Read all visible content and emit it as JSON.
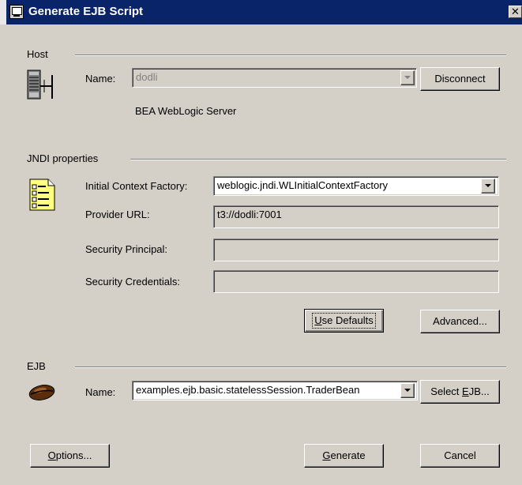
{
  "window": {
    "title": "Generate EJB Script"
  },
  "host": {
    "section_label": "Host",
    "name_label": "Name:",
    "name_value": "dodli",
    "disconnect_label": "Disconnect",
    "server_label": "BEA WebLogic Server"
  },
  "jndi": {
    "section_label": "JNDI properties",
    "factory_label": "Initial Context Factory:",
    "factory_value": "weblogic.jndi.WLInitialContextFactory",
    "provider_label": "Provider URL:",
    "provider_value": "t3://dodli:7001",
    "principal_label": "Security Principal:",
    "principal_value": "",
    "credentials_label": "Security Credentials:",
    "credentials_value": "",
    "use_defaults": {
      "pre": "",
      "u": "U",
      "post": "se Defaults"
    },
    "advanced": {
      "pre": "Advanced",
      "u": "",
      "post": "..."
    }
  },
  "ejb": {
    "section_label": "EJB",
    "name_label": "Name:",
    "name_value": "examples.ejb.basic.statelessSession.TraderBean",
    "select_ejb": {
      "pre": "Select ",
      "u": "E",
      "post": "JB..."
    }
  },
  "footer": {
    "options": {
      "pre": "",
      "u": "O",
      "post": "ptions..."
    },
    "generate": {
      "pre": "",
      "u": "G",
      "post": "enerate"
    },
    "cancel": "Cancel"
  },
  "colors": {
    "title_bar": "#0a246a",
    "dialog_face": "#d4d0c8"
  }
}
